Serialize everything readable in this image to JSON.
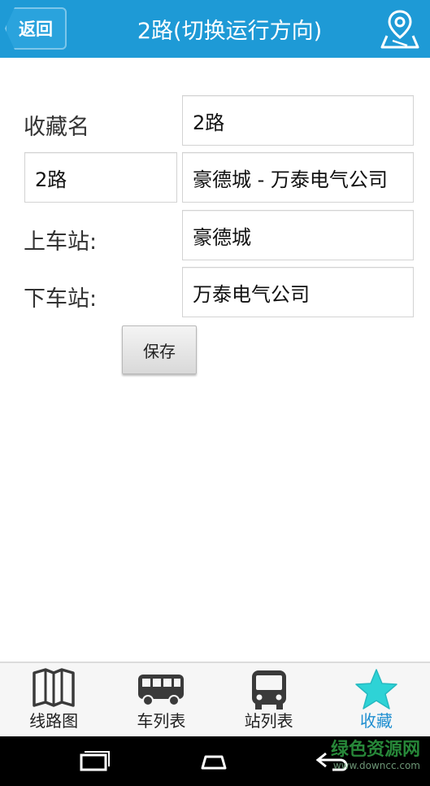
{
  "header": {
    "back_label": "返回",
    "title": "2路(切换运行方向)",
    "accent": "#1e9ad6"
  },
  "form": {
    "fav_name_label": "收藏名",
    "fav_name_value": "2路",
    "route_value": "2路",
    "direction_value": "豪德城 - 万泰电气公司",
    "board_label": "上车站:",
    "board_value": "豪德城",
    "alight_label": "下车站:",
    "alight_value": "万泰电气公司",
    "save_label": "保存"
  },
  "tabs": [
    {
      "label": "线路图",
      "icon": "map-icon",
      "active": false
    },
    {
      "label": "车列表",
      "icon": "bus-icon",
      "active": false
    },
    {
      "label": "站列表",
      "icon": "bus-front-icon",
      "active": false
    },
    {
      "label": "收藏",
      "icon": "star-icon",
      "active": true
    }
  ],
  "watermark": {
    "line1": "绿色资源网",
    "line2": "www.downcc.com"
  }
}
